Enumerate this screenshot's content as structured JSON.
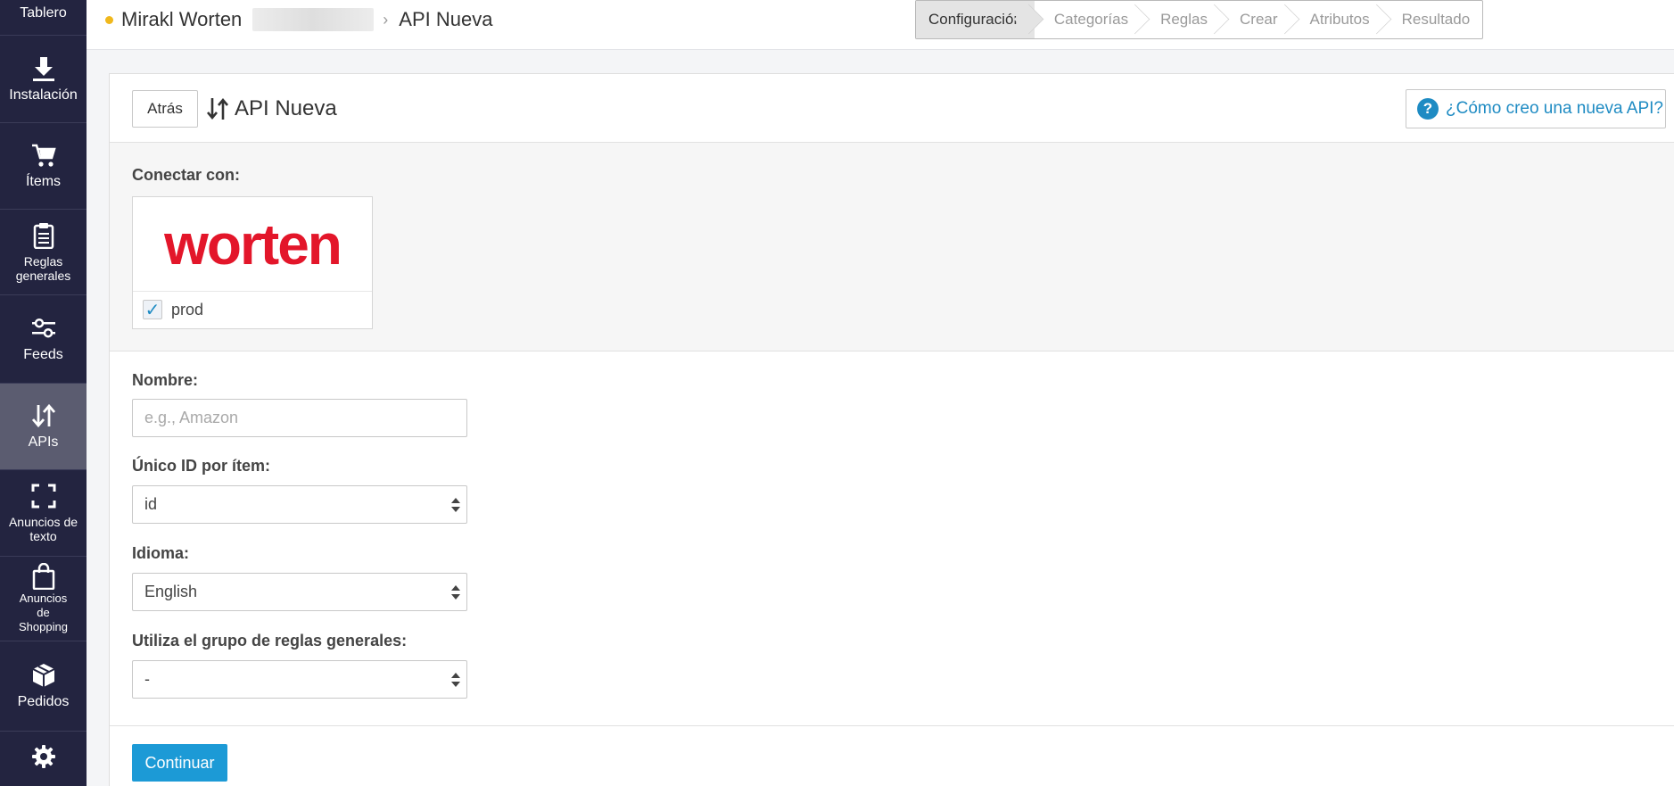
{
  "sidebar": {
    "items": [
      {
        "label": "Tablero",
        "icon": "dashboard-icon"
      },
      {
        "label": "Instalación",
        "icon": "download-icon"
      },
      {
        "label": "Ítems",
        "icon": "cart-icon"
      },
      {
        "label": "Reglas generales",
        "icon": "clipboard-icon"
      },
      {
        "label": "Feeds",
        "icon": "sliders-icon"
      },
      {
        "label": "APIs",
        "icon": "arrows-updown-icon",
        "active": true
      },
      {
        "label": "Anuncios de texto",
        "icon": "expand-icon"
      },
      {
        "label": "Anuncios de Shopping",
        "icon": "shopping-bag-icon"
      },
      {
        "label": "Pedidos",
        "icon": "box-icon"
      },
      {
        "label": "",
        "icon": "gear-icon"
      }
    ]
  },
  "breadcrumb": {
    "account": "Mirakl Worten",
    "current": "API Nueva"
  },
  "steps": [
    {
      "label": "Configuración",
      "active": true
    },
    {
      "label": "Categorías"
    },
    {
      "label": "Reglas"
    },
    {
      "label": "Crear"
    },
    {
      "label": "Atributos"
    },
    {
      "label": "Resultado"
    }
  ],
  "card": {
    "back_label": "Atrás",
    "title": "API Nueva",
    "help_label": "¿Cómo creo una nueva API?"
  },
  "connect": {
    "label": "Conectar con:",
    "logo_text": "worten",
    "checkbox_label": "prod",
    "checked": true
  },
  "form": {
    "name_label": "Nombre:",
    "name_placeholder": "e.g., Amazon",
    "unique_id_label": "Único ID por ítem:",
    "unique_id_value": "id",
    "language_label": "Idioma:",
    "language_value": "English",
    "rules_group_label": "Utiliza el grupo de reglas generales:",
    "rules_group_value": "-"
  },
  "continue_label": "Continuar",
  "colors": {
    "sidebar_bg": "#232440",
    "accent": "#1c9ad6",
    "brand_red": "#e3162a"
  }
}
